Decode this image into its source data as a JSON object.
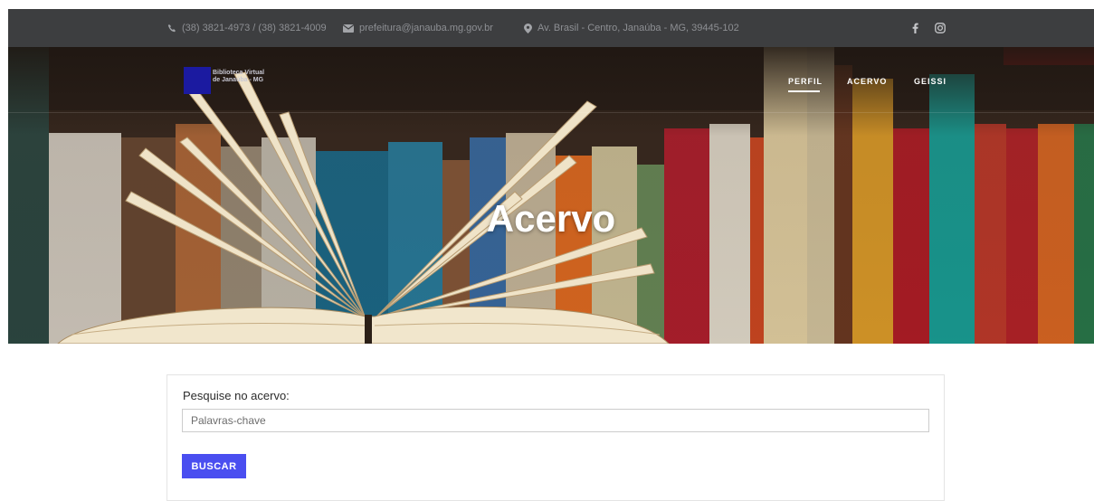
{
  "topbar": {
    "phone": "(38) 3821-4973 / (38) 3821-4009",
    "email": "prefeitura@janauba.mg.gov.br",
    "address": "Av. Brasil - Centro, Janaúba - MG, 39445-102",
    "social_icons": [
      "facebook-icon",
      "instagram-icon"
    ]
  },
  "header": {
    "logo_line1": "Biblioteca Virtual",
    "logo_line2": "de Janaúba - MG",
    "nav": [
      {
        "label": "PERFIL",
        "active": true
      },
      {
        "label": "ACERVO",
        "active": false
      },
      {
        "label": "GEISSI",
        "active": false
      }
    ]
  },
  "hero": {
    "title": "Acervo"
  },
  "search": {
    "label": "Pesquise no acervo:",
    "placeholder": "Palavras-chave",
    "button": "BUSCAR"
  },
  "colors": {
    "topbar_bg": "#3d3e40",
    "logo": "#1b1aa0",
    "button": "#4a4ef0"
  }
}
